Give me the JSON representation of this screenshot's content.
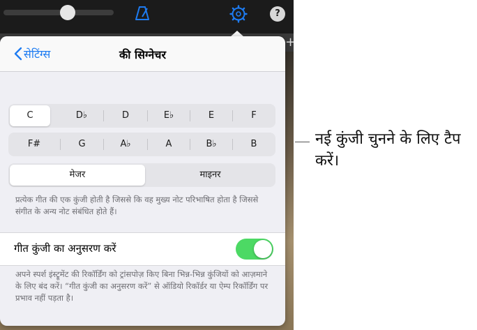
{
  "nav": {
    "back_label": "सेटिंग्स",
    "title": "की सिग्नेचर"
  },
  "keys": {
    "row1": [
      "C",
      "D♭",
      "D",
      "E♭",
      "E",
      "F"
    ],
    "row2": [
      "F#",
      "G",
      "A♭",
      "A",
      "B♭",
      "B"
    ],
    "selected": "C"
  },
  "mode": {
    "options": [
      "मेजर",
      "माइनर"
    ],
    "selected": "मेजर"
  },
  "key_description": "प्रत्येक गीत की एक कुंजी होती है जिससे कि वह मुख्य नोट परिभाषित होता है जिससे संगीत के अन्य नोट संबंधित होते हैं।",
  "follow_song_key": {
    "label": "गीत कुंजी का अनुसरण करें",
    "enabled": true
  },
  "follow_description": "अपने स्पर्श इंस्ट्रूमेंट की रिकॉर्डिंग को ट्रांसपोज़ किए बिना भिन्न-भिन्न कुंजियों को आज़माने के लिए बंद करें। “गीत कुंजी का अनुसरण करें” से ऑडियो रिकॉर्डर या ऐम्प रिकॉर्डिंग पर प्रभाव नहीं पड़ता है।",
  "toolbar": {
    "help_label": "?"
  },
  "callout": "नई कुंजी चुनने के लिए टैप करें।",
  "colors": {
    "accent": "#1e7cf2",
    "toggle_on": "#4cd964"
  }
}
